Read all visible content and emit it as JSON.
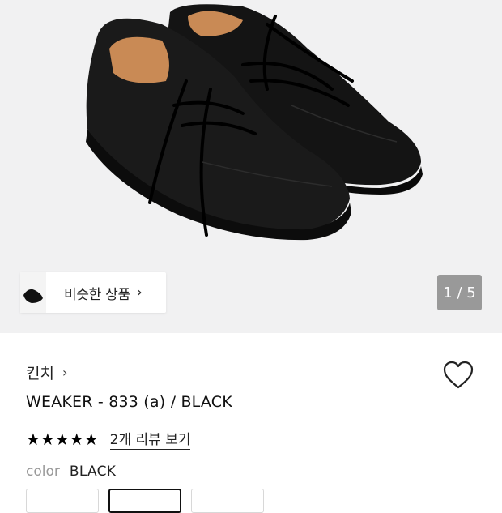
{
  "similar_products": {
    "label": "비슷한 상품",
    "chevron": "›"
  },
  "gallery": {
    "counter": "1 / 5"
  },
  "product": {
    "brand": "킨치",
    "brand_chevron": "›",
    "title": "WEAKER - 833 (a) / BLACK",
    "stars": "★★★★★",
    "rating_value": 5,
    "review_link": "2개 리뷰 보기",
    "color_label": "color",
    "color_value": "BLACK",
    "options_count": 3,
    "selected_option_index": 1
  },
  "icons": {
    "heart": "heart-outline-icon",
    "chevron": "chevron-right-icon",
    "stars": "star-icon"
  },
  "colors": {
    "hero_bg": "#f1f1f2",
    "counter_bg": "#8a8a8a",
    "text": "#111111",
    "muted": "#999999"
  }
}
